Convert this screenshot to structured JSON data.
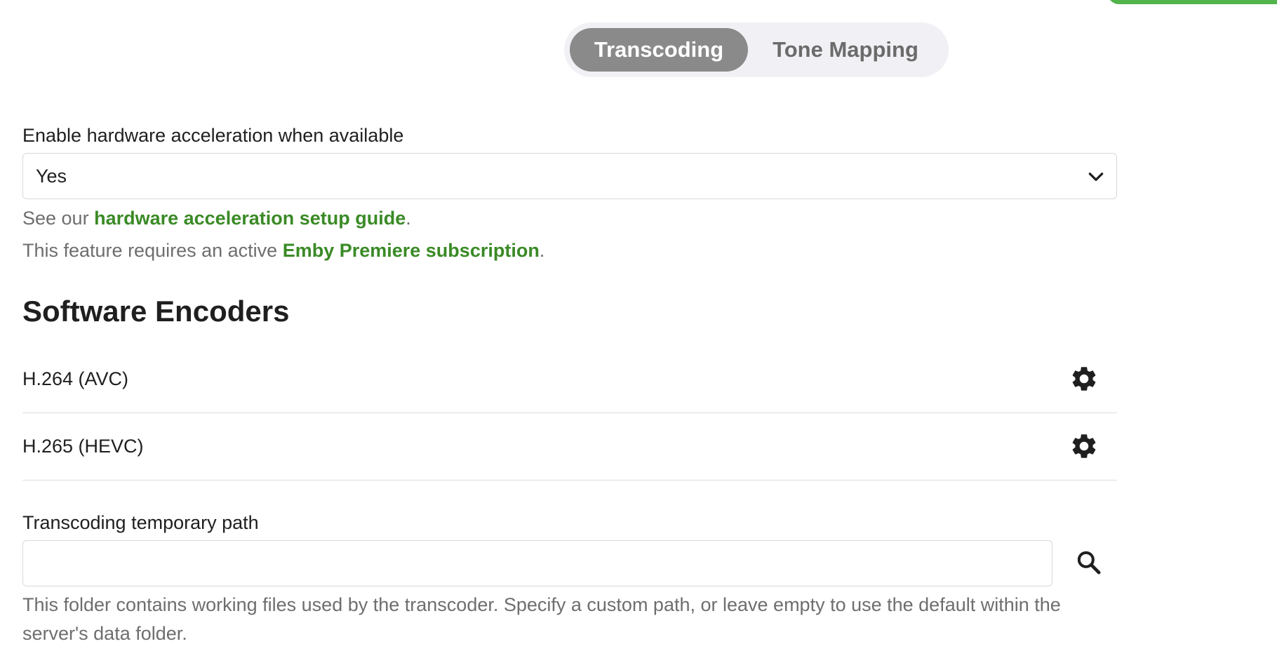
{
  "tabs": [
    {
      "label": "Transcoding",
      "active": true
    },
    {
      "label": "Tone Mapping",
      "active": false
    }
  ],
  "hardware_acceleration": {
    "label": "Enable hardware acceleration when available",
    "selected": "Yes",
    "help1_prefix": "See our ",
    "help1_link": "hardware acceleration setup guide",
    "help1_suffix": ".",
    "help2_prefix": "This feature requires an active ",
    "help2_link": "Emby Premiere subscription",
    "help2_suffix": "."
  },
  "software_encoders": {
    "title": "Software Encoders",
    "items": [
      {
        "label": "H.264 (AVC)"
      },
      {
        "label": "H.265 (HEVC)"
      }
    ]
  },
  "transcoding_path": {
    "label": "Transcoding temporary path",
    "value": "",
    "description": "This folder contains working files used by the transcoder. Specify a custom path, or leave empty to use the default within the server's data folder."
  },
  "colors": {
    "accent": "#52b54b",
    "link": "#3a8a26",
    "active_tab": "#8a8a8a"
  },
  "icons": {
    "select_arrow": "chevron-down-icon",
    "encoder_settings": "gear-icon",
    "browse": "search-icon"
  }
}
